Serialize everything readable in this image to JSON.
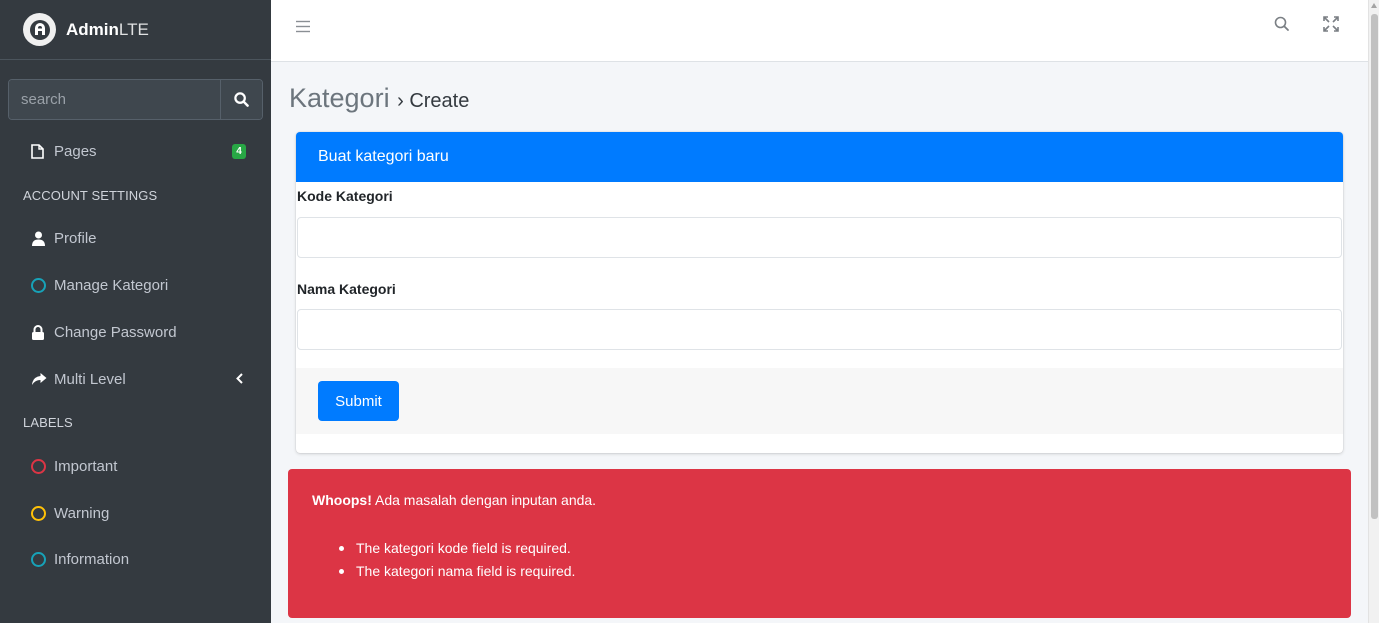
{
  "brand": {
    "bold": "Admin",
    "light": "LTE",
    "logo_icon": "adminlte-logo-icon"
  },
  "sidebar": {
    "search_placeholder": "search",
    "items": [
      {
        "label": "Pages",
        "icon": "file-icon",
        "badge": "4"
      },
      {
        "label": "Profile",
        "icon": "user-icon"
      },
      {
        "label": "Manage Kategori",
        "icon": "circle-icon"
      },
      {
        "label": "Change Password",
        "icon": "lock-icon"
      },
      {
        "label": "Multi Level",
        "icon": "share-icon"
      },
      {
        "label": "Important",
        "icon": "circle-icon"
      },
      {
        "label": "Warning",
        "icon": "circle-icon"
      },
      {
        "label": "Information",
        "icon": "circle-icon"
      }
    ],
    "headers": [
      "ACCOUNT SETTINGS",
      "LABELS"
    ],
    "label_colors": {
      "important": "#dc3545",
      "warning": "#ffc107",
      "information": "#17a2b8",
      "manage": "#17a2b8"
    }
  },
  "page": {
    "title": "Kategori",
    "subtitle": "Create"
  },
  "card": {
    "header": "Buat kategori baru",
    "fields": [
      {
        "label": "Kode Kategori",
        "value": ""
      },
      {
        "label": "Nama Kategori",
        "value": ""
      }
    ],
    "submit_label": "Submit"
  },
  "alert": {
    "strong": "Whoops!",
    "message": "Ada masalah dengan inputan anda.",
    "errors": [
      "The kategori kode field is required.",
      "The kategori nama field is required."
    ]
  },
  "colors": {
    "primary": "#007bff",
    "danger": "#dc3545",
    "sidebar_bg": "#343a40",
    "badge": "#28a745"
  }
}
